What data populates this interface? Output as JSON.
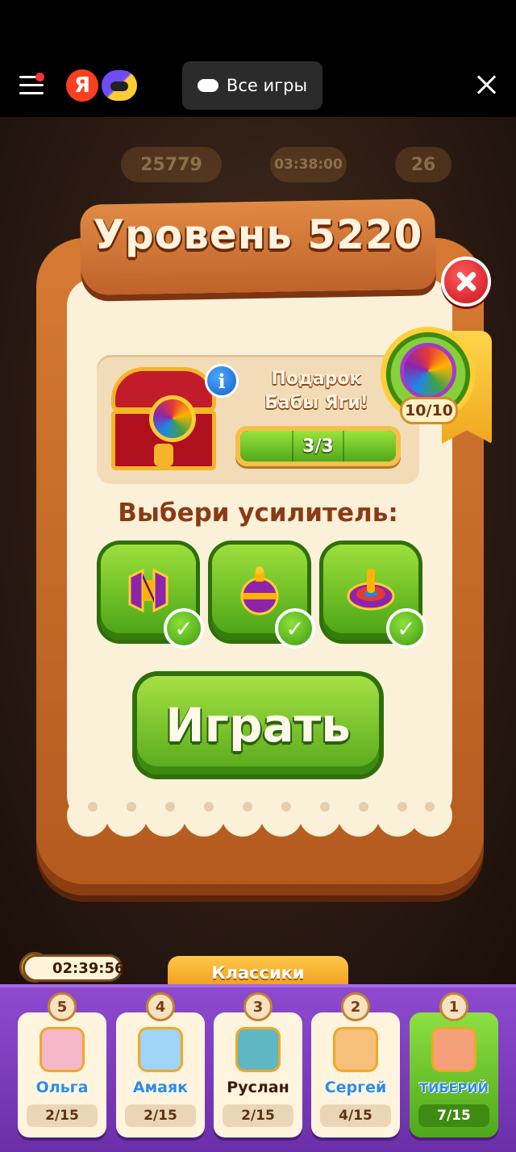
{
  "topbar": {
    "logo_letter": "Я",
    "all_games_label": "Все игры"
  },
  "hud": {
    "coins": "25779",
    "lives_timer": "03:38:00",
    "stars": "26"
  },
  "dialog": {
    "title": "Уровень 5220",
    "gift": {
      "info_symbol": "i",
      "text_line1": "Подарок",
      "text_line2": "Бабы Яги!",
      "progress_label": "3/3",
      "progress_fraction": 1.0,
      "badge_count": "10/10"
    },
    "choose_label": "Выбери усилитель:",
    "boosters": [
      {
        "name": "hammer",
        "selected": true
      },
      {
        "name": "bomb",
        "selected": true
      },
      {
        "name": "spinning-top",
        "selected": true
      }
    ],
    "play_label": "Играть"
  },
  "bottom": {
    "timer": "02:39:56",
    "category": "Классики",
    "players": [
      {
        "rank": "5",
        "name": "Ольга",
        "score": "2/15",
        "name_color": "#2f8be0"
      },
      {
        "rank": "4",
        "name": "Амаяк",
        "score": "2/15",
        "name_color": "#2f8be0"
      },
      {
        "rank": "3",
        "name": "Руслан",
        "score": "2/15",
        "name_color": "#3b1a06"
      },
      {
        "rank": "2",
        "name": "Сергей",
        "score": "4/15",
        "name_color": "#2f8be0"
      },
      {
        "rank": "1",
        "name": "ТИБЕРИЙ",
        "score": "7/15",
        "name_color": "#2f8be0"
      }
    ]
  },
  "colors": {
    "accent_green": "#56a81b",
    "wood": "#c0622a",
    "paper": "#fbf0d8",
    "bottom_bar": "#7a38bb"
  }
}
